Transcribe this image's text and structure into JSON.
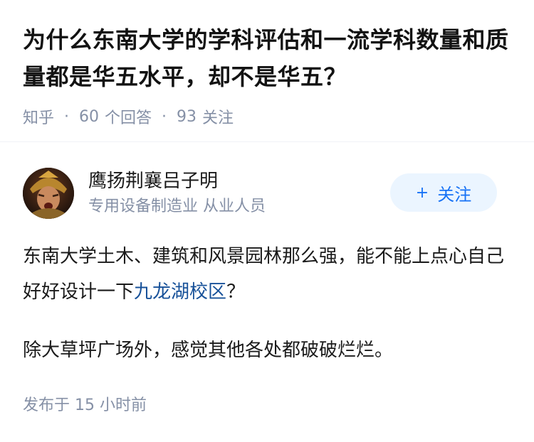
{
  "question": {
    "title": "为什么东南大学的学科评估和一流学科数量和质量都是华五水平，却不是华五？",
    "source": "知乎",
    "answer_count": "60",
    "answer_label": "个回答",
    "follower_count": "93",
    "follower_label": "关注"
  },
  "answer": {
    "author_name": "鹰扬荆襄吕子明",
    "author_headline": "专用设备制造业 从业人员",
    "follow_label": "关注",
    "follow_icon": "plus-icon",
    "para1_text": "东南大学土木、建筑和风景园林那么强，能不能上点心自己好好设计一下",
    "para1_link": "九龙湖校区",
    "para1_tail": "？",
    "para2": "除大草坪广场外，感觉其他各处都破破烂烂。",
    "published": "发布于 15 小时前"
  },
  "colors": {
    "link": "#175199",
    "follow_bg": "#ebf5ff",
    "follow_text": "#1772f6",
    "meta": "#8590a6"
  }
}
